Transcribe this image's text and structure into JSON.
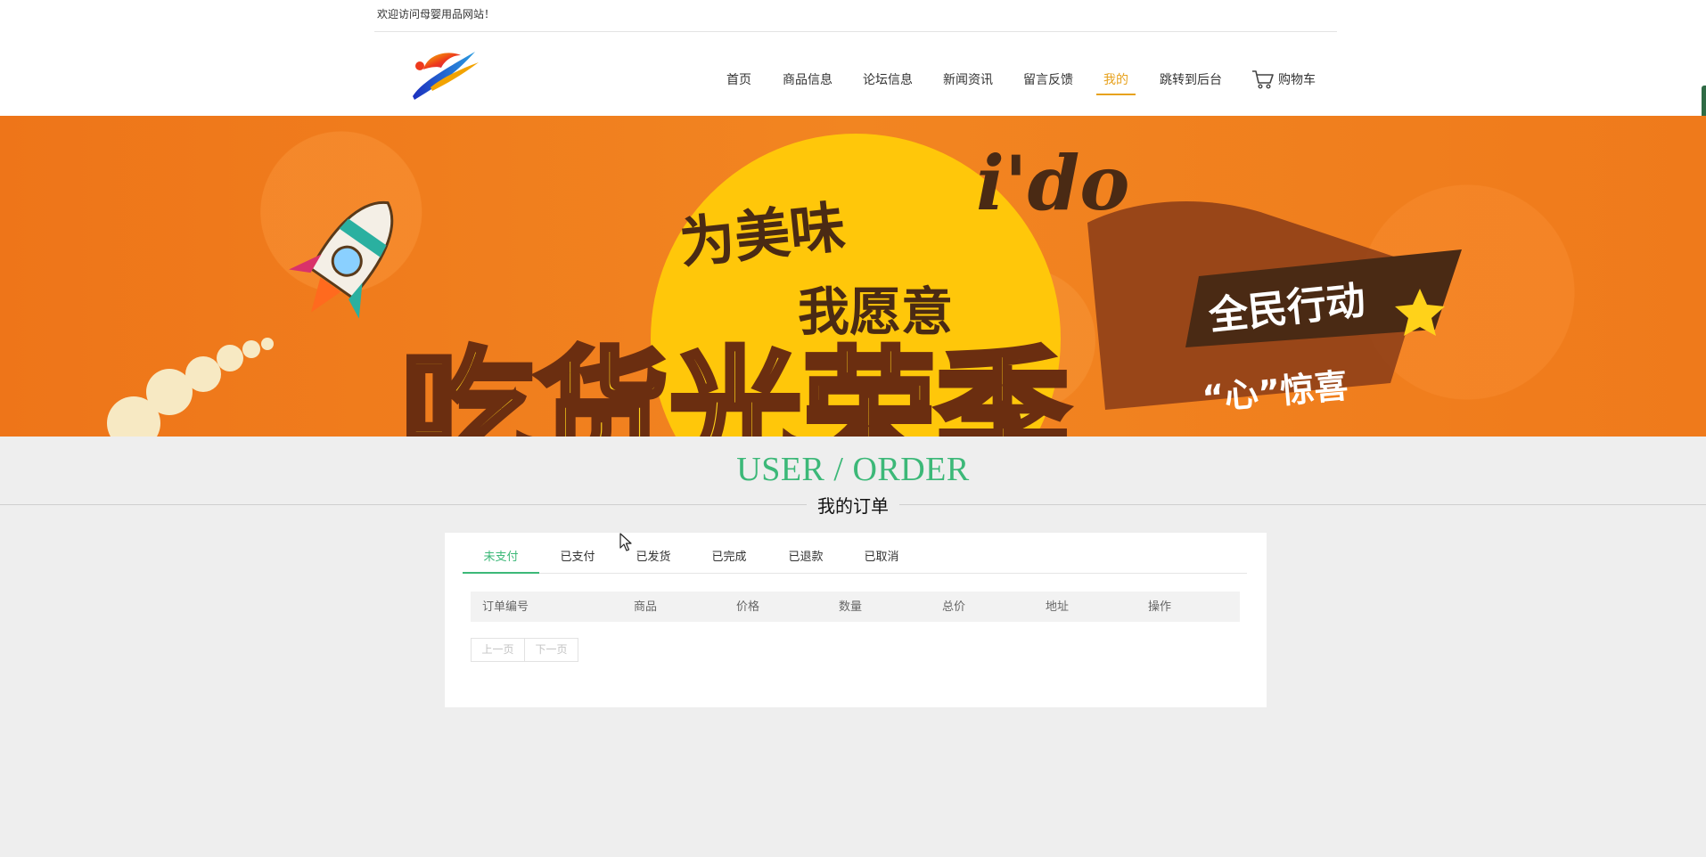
{
  "header": {
    "welcome": "欢迎访问母婴用品网站！",
    "nav": [
      {
        "label": "首页"
      },
      {
        "label": "商品信息"
      },
      {
        "label": "论坛信息"
      },
      {
        "label": "新闻资讯"
      },
      {
        "label": "留言反馈"
      },
      {
        "label": "我的"
      },
      {
        "label": "跳转到后台"
      }
    ],
    "active_nav": "我的",
    "cart_label": "购物车",
    "logo_icon": "flame-swoosh-logo-icon",
    "cart_icon": "shopping-cart-icon"
  },
  "banner": {
    "text_line1": "为美味",
    "text_brand": "i'do",
    "text_line2": "我愿意",
    "text_main": "吃货光荣季",
    "text_tag1": "全民行动",
    "text_tag2": "“心”惊喜"
  },
  "section": {
    "title_en": "USER / ORDER",
    "title_cn": "我的订单"
  },
  "orders": {
    "tabs": [
      {
        "label": "未支付"
      },
      {
        "label": "已支付"
      },
      {
        "label": "已发货"
      },
      {
        "label": "已完成"
      },
      {
        "label": "已退款"
      },
      {
        "label": "已取消"
      }
    ],
    "active_tab": "未支付",
    "columns": [
      {
        "label": "订单编号"
      },
      {
        "label": "商品"
      },
      {
        "label": "价格"
      },
      {
        "label": "数量"
      },
      {
        "label": "总价"
      },
      {
        "label": "地址"
      },
      {
        "label": "操作"
      }
    ],
    "rows": [],
    "pager": {
      "prev": "上一页",
      "next": "下一页"
    }
  },
  "colors": {
    "accent_green": "#3cb878",
    "nav_active": "#e7a21e",
    "banner_orange": "#f07c1c"
  }
}
